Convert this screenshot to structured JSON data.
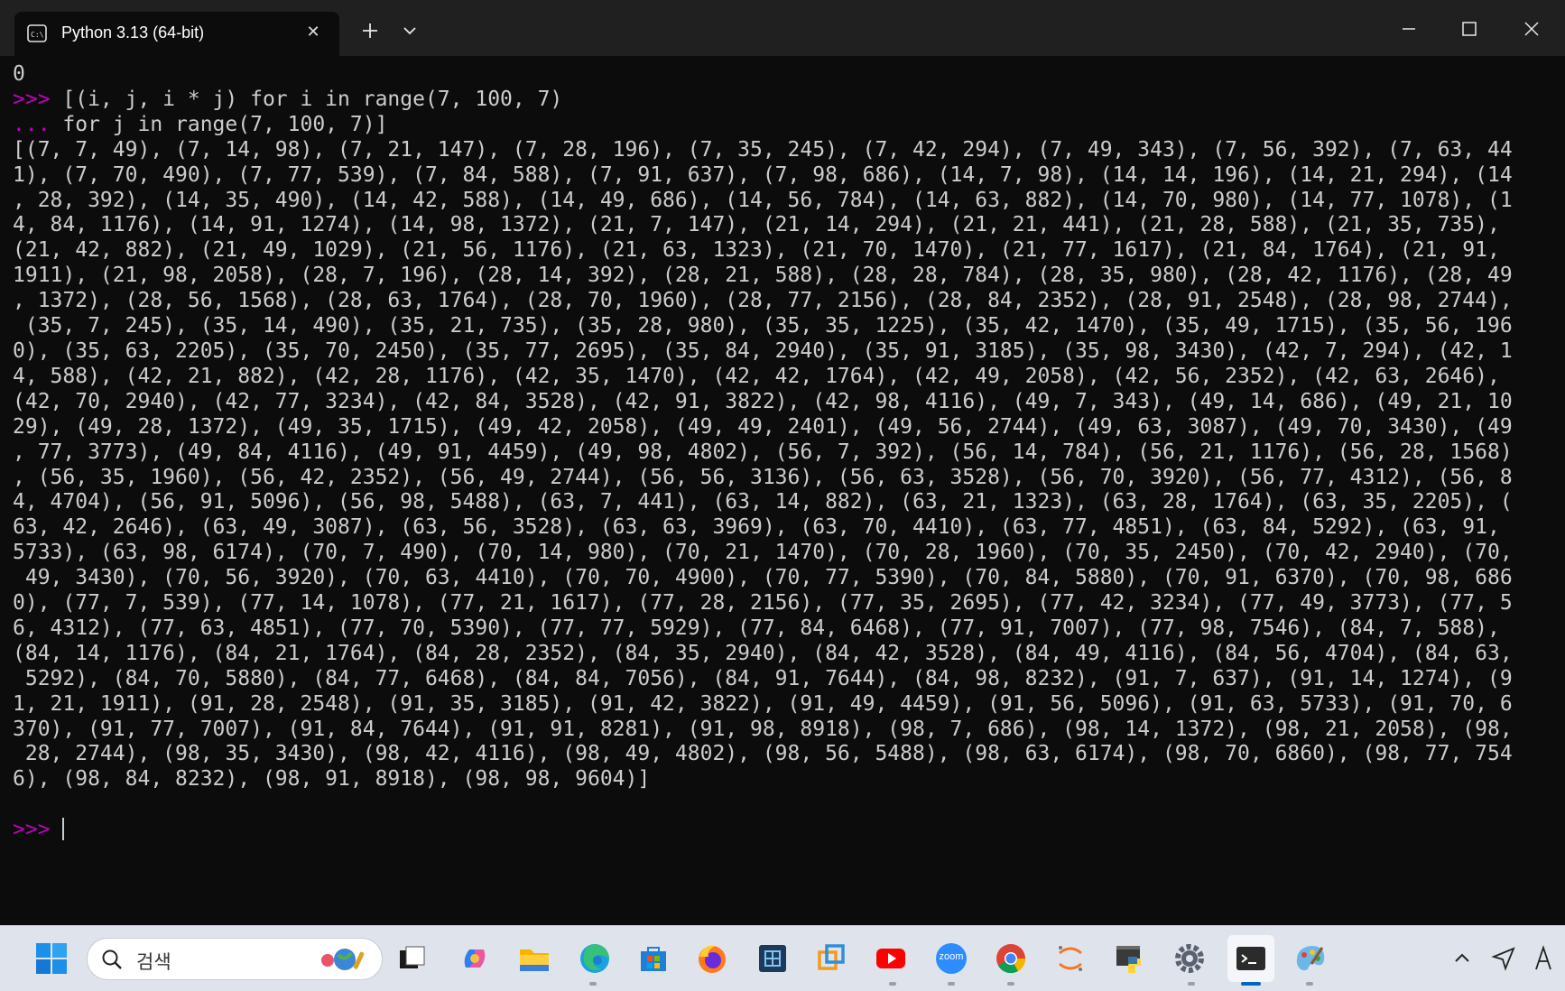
{
  "window": {
    "tab_title": "Python 3.13 (64-bit)",
    "tab_icon": "terminal-app-icon",
    "accent": "#c000c0"
  },
  "terminal": {
    "lines": [
      "0",
      "",
      "",
      "[(7, 7, 49), (7, 14, 98), (7, 21, 147), (7, 28, 196), (7, 35, 245), (7, 42, 294), (7, 49, 343), (7, 56, 392), (7, 63, 44",
      "1), (7, 70, 490), (7, 77, 539), (7, 84, 588), (7, 91, 637), (7, 98, 686), (14, 7, 98), (14, 14, 196), (14, 21, 294), (14",
      ", 28, 392), (14, 35, 490), (14, 42, 588), (14, 49, 686), (14, 56, 784), (14, 63, 882), (14, 70, 980), (14, 77, 1078), (1",
      "4, 84, 1176), (14, 91, 1274), (14, 98, 1372), (21, 7, 147), (21, 14, 294), (21, 21, 441), (21, 28, 588), (21, 35, 735),",
      "(21, 42, 882), (21, 49, 1029), (21, 56, 1176), (21, 63, 1323), (21, 70, 1470), (21, 77, 1617), (21, 84, 1764), (21, 91,",
      "1911), (21, 98, 2058), (28, 7, 196), (28, 14, 392), (28, 21, 588), (28, 28, 784), (28, 35, 980), (28, 42, 1176), (28, 49",
      ", 1372), (28, 56, 1568), (28, 63, 1764), (28, 70, 1960), (28, 77, 2156), (28, 84, 2352), (28, 91, 2548), (28, 98, 2744),",
      " (35, 7, 245), (35, 14, 490), (35, 21, 735), (35, 28, 980), (35, 35, 1225), (35, 42, 1470), (35, 49, 1715), (35, 56, 196",
      "0), (35, 63, 2205), (35, 70, 2450), (35, 77, 2695), (35, 84, 2940), (35, 91, 3185), (35, 98, 3430), (42, 7, 294), (42, 1",
      "4, 588), (42, 21, 882), (42, 28, 1176), (42, 35, 1470), (42, 42, 1764), (42, 49, 2058), (42, 56, 2352), (42, 63, 2646),",
      "(42, 70, 2940), (42, 77, 3234), (42, 84, 3528), (42, 91, 3822), (42, 98, 4116), (49, 7, 343), (49, 14, 686), (49, 21, 10",
      "29), (49, 28, 1372), (49, 35, 1715), (49, 42, 2058), (49, 49, 2401), (49, 56, 2744), (49, 63, 3087), (49, 70, 3430), (49",
      ", 77, 3773), (49, 84, 4116), (49, 91, 4459), (49, 98, 4802), (56, 7, 392), (56, 14, 784), (56, 21, 1176), (56, 28, 1568)",
      ", (56, 35, 1960), (56, 42, 2352), (56, 49, 2744), (56, 56, 3136), (56, 63, 3528), (56, 70, 3920), (56, 77, 4312), (56, 8",
      "4, 4704), (56, 91, 5096), (56, 98, 5488), (63, 7, 441), (63, 14, 882), (63, 21, 1323), (63, 28, 1764), (63, 35, 2205), (",
      "63, 42, 2646), (63, 49, 3087), (63, 56, 3528), (63, 63, 3969), (63, 70, 4410), (63, 77, 4851), (63, 84, 5292), (63, 91,",
      "5733), (63, 98, 6174), (70, 7, 490), (70, 14, 980), (70, 21, 1470), (70, 28, 1960), (70, 35, 2450), (70, 42, 2940), (70,",
      " 49, 3430), (70, 56, 3920), (70, 63, 4410), (70, 70, 4900), (70, 77, 5390), (70, 84, 5880), (70, 91, 6370), (70, 98, 686",
      "0), (77, 7, 539), (77, 14, 1078), (77, 21, 1617), (77, 28, 2156), (77, 35, 2695), (77, 42, 3234), (77, 49, 3773), (77, 5",
      "6, 4312), (77, 63, 4851), (77, 70, 5390), (77, 77, 5929), (77, 84, 6468), (77, 91, 7007), (77, 98, 7546), (84, 7, 588),",
      "(84, 14, 1176), (84, 21, 1764), (84, 28, 2352), (84, 35, 2940), (84, 42, 3528), (84, 49, 4116), (84, 56, 4704), (84, 63,",
      " 5292), (84, 70, 5880), (84, 77, 6468), (84, 84, 7056), (84, 91, 7644), (84, 98, 8232), (91, 7, 637), (91, 14, 1274), (9",
      "1, 21, 1911), (91, 28, 2548), (91, 35, 3185), (91, 42, 3822), (91, 49, 4459), (91, 56, 5096), (91, 63, 5733), (91, 70, 6",
      "370), (91, 77, 7007), (91, 84, 7644), (91, 91, 8281), (91, 98, 8918), (98, 7, 686), (98, 14, 1372), (98, 21, 2058), (98,",
      " 28, 2744), (98, 35, 3430), (98, 42, 4116), (98, 49, 4802), (98, 56, 5488), (98, 63, 6174), (98, 70, 6860), (98, 77, 754",
      "6), (98, 84, 8232), (98, 91, 8918), (98, 98, 9604)]",
      ""
    ],
    "input_lines": [
      {
        "prompt": ">>> ",
        "code": "[(i, j, i * j) for i in range(7, 100, 7)"
      },
      {
        "prompt": "... ",
        "code": "for j in range(7, 100, 7)]"
      }
    ],
    "final_prompt": ">>> "
  },
  "taskbar": {
    "search_placeholder": "검색",
    "apps": [
      "start-icon",
      "task-view-icon",
      "copilot-icon",
      "file-explorer-icon",
      "edge-icon",
      "store-icon",
      "firefox-icon",
      "sandbox-icon",
      "vmware-icon",
      "youtube-icon",
      "zoom-icon",
      "chrome-icon",
      "jupyter-icon",
      "python-idle-icon",
      "settings-icon",
      "terminal-icon",
      "paint-icon"
    ],
    "zoom_label": "zoom"
  }
}
